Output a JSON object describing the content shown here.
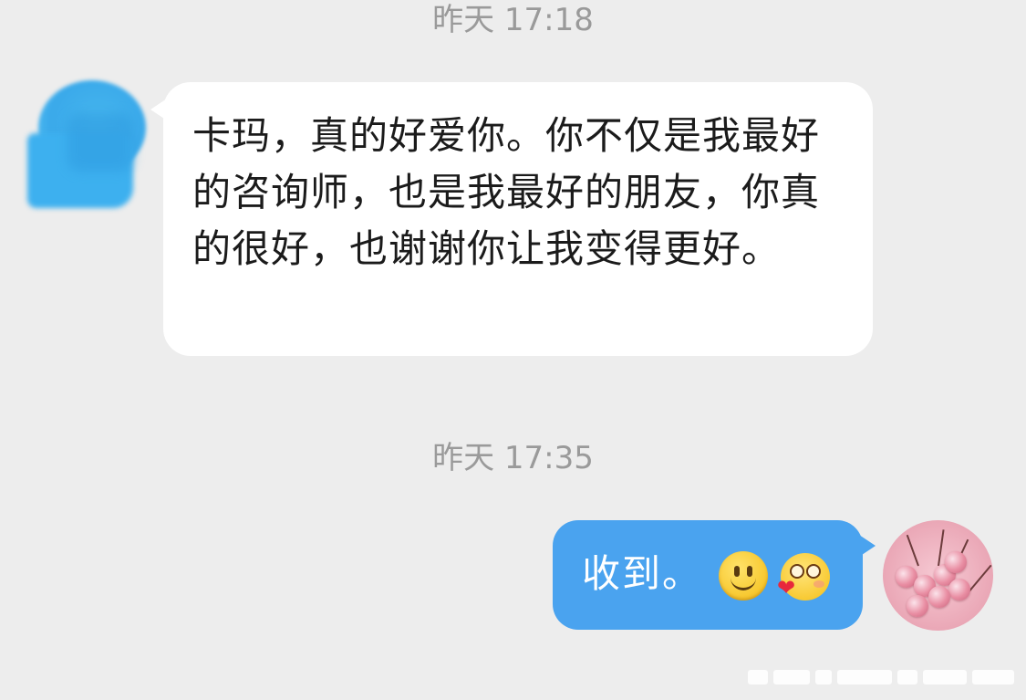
{
  "conversation": {
    "timestamps": [
      "昨天 17:18",
      "昨天 17:35"
    ],
    "received_message": {
      "text": "卡玛，真的好爱你。你不仅是我最好的咨询师，也是我最好的朋友，你真的很好，也谢谢你让我变得更好。"
    },
    "sent_message": {
      "text": "收到。",
      "emojis": [
        "slightly-smiling-face-icon",
        "blushing-heart-face-icon"
      ]
    }
  },
  "colors": {
    "background": "#ededed",
    "received_bubble": "#ffffff",
    "sent_bubble": "#4aa3ef",
    "timestamp": "#9a9a9a"
  }
}
